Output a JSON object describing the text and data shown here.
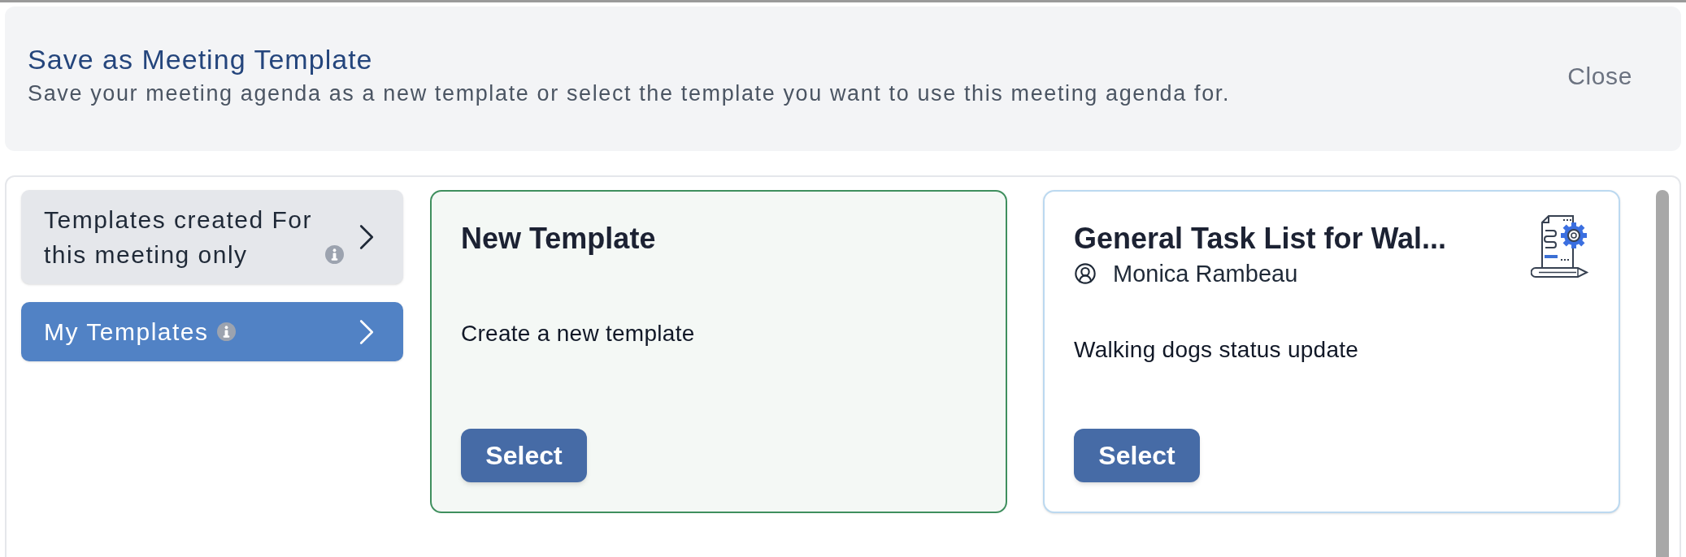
{
  "header": {
    "title": "Save as Meeting Template",
    "subtitle": "Save your meeting agenda as a new template or select the template you want to use this meeting agenda for.",
    "close": "Close"
  },
  "sidebar": {
    "items": [
      {
        "label": "Templates created For this meeting only",
        "selected": false
      },
      {
        "label": "My Templates",
        "selected": true
      }
    ]
  },
  "templates": [
    {
      "kind": "new",
      "title": "New Template",
      "description": "Create a new template",
      "button": "Select"
    },
    {
      "kind": "existing",
      "title": "General Task List for Wal...",
      "owner": "Monica Rambeau",
      "description": "Walking dogs status update",
      "button": "Select"
    }
  ]
}
